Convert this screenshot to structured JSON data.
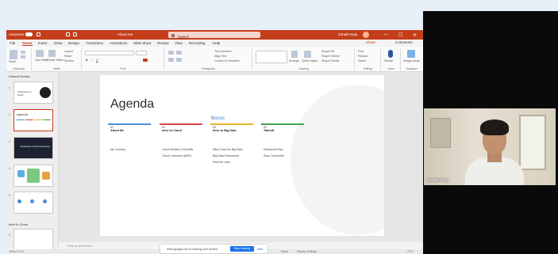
{
  "window": {
    "autosave_label": "AutoSave",
    "doc_title": "About me",
    "search_placeholder": "Search",
    "user_name": "Zohaib Raja",
    "minimize": "—",
    "maximize": "☐",
    "close": "✕"
  },
  "menu": {
    "tabs": [
      "File",
      "Home",
      "Insert",
      "Draw",
      "Design",
      "Transitions",
      "Animations",
      "Slide Show",
      "Review",
      "View",
      "Recording",
      "Help"
    ],
    "active_tab": "Home",
    "share_label": "Share",
    "comments_label": "Comments"
  },
  "ribbon": {
    "groups": [
      "Clipboard",
      "Slides",
      "Font",
      "Paragraph",
      "Drawing",
      "Editing",
      "Voice",
      "Designer"
    ],
    "paste_label": "Paste",
    "new_slide_label": "New Slide",
    "reuse_label": "Reuse Slides",
    "layout_label": "Layout",
    "reset_label": "Reset",
    "section_label": "Section",
    "text_direction_label": "Text Direction",
    "align_text_label": "Align Text",
    "smartart_label": "Convert to SmartArt",
    "arrange_label": "Arrange",
    "quick_styles_label": "Quick Styles",
    "shape_fill_label": "Shape Fill",
    "shape_outline_label": "Shape Outline",
    "shape_effects_label": "Shape Effects",
    "find_label": "Find",
    "replace_label": "Replace",
    "select_label": "Select",
    "dictate_label": "Dictate",
    "designer_label": "Design Ideas"
  },
  "thumbnails": {
    "section1": "Default Section",
    "section2": "Intro to Cloud",
    "slide_numbers": [
      "1",
      "2",
      "3",
      "4",
      "5",
      "6"
    ],
    "slide1_text": "Introduction to Cloud",
    "slide2_title": "Agenda",
    "slide3_text": "Introduction to Cloud Computing"
  },
  "slide": {
    "title": "Agenda",
    "bonus": "Bonus",
    "columns": [
      {
        "num": "01",
        "head": "About Me",
        "items": [
          "My Journey"
        ],
        "color": "#4a8fd6"
      },
      {
        "num": "02",
        "head": "Intro to Cloud",
        "items": [
          "Cloud Models & Benefits",
          "Cloud Concepts (AWS)"
        ],
        "color": "#d64545"
      },
      {
        "num": "03",
        "head": "Intro to Big Data",
        "items": [
          "Why Cloud for Big Data",
          "Big Data Framework",
          "Real life Uses"
        ],
        "color": "#e8b52a"
      },
      {
        "num": "04",
        "head": "Takeoff",
        "items": [
          "Resources/Tips",
          "Stay Connected"
        ],
        "color": "#3fa34d"
      }
    ]
  },
  "notes": {
    "placeholder": "Click to add notes"
  },
  "status": {
    "left": "Slide 2 of 6",
    "notes": "Notes",
    "display": "Display Settings",
    "zoom": "77%"
  },
  "share_banner": {
    "message": "meet.google.com is sharing your screen.",
    "stop": "Stop sharing",
    "hide": "Hide"
  },
  "video": {
    "participant": "Zohaib Raja"
  },
  "colors": {
    "accent": "#c43e1c",
    "meet_blue": "#1a73e8"
  }
}
